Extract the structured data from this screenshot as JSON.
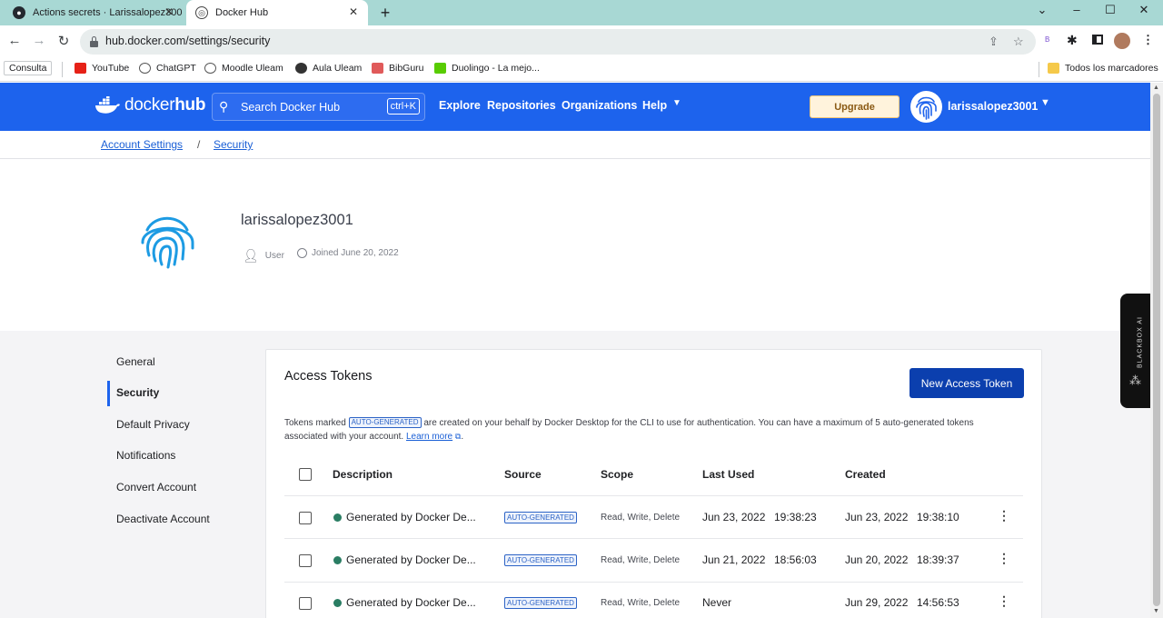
{
  "browser": {
    "tabs": [
      {
        "title": "Actions secrets · Larissalopez300"
      },
      {
        "title": "Docker Hub"
      }
    ],
    "url": "hub.docker.com/settings/security",
    "bookmarks": [
      "Consulta",
      "YouTube",
      "ChatGPT",
      "Moodle Uleam",
      "Aula Uleam",
      "BibGuru",
      "Duolingo - La mejo..."
    ],
    "all_bookmarks": "Todos los marcadores",
    "extension_label": "B"
  },
  "header": {
    "logo_text": "docker",
    "logo_text2": "hub",
    "search_placeholder": "Search Docker Hub",
    "search_shortcut": "ctrl+K",
    "nav": [
      "Explore",
      "Repositories",
      "Organizations",
      "Help"
    ],
    "upgrade_label": "Upgrade",
    "username": "larissalopez3001"
  },
  "breadcrumb": {
    "items": [
      "Account Settings",
      "Security"
    ],
    "separator": "/"
  },
  "profile": {
    "name": "larissalopez3001",
    "role": "User",
    "joined": "Joined June 20, 2022"
  },
  "settings_nav": {
    "items": [
      "General",
      "Security",
      "Default Privacy",
      "Notifications",
      "Convert Account",
      "Deactivate Account"
    ],
    "active": "Security"
  },
  "tokens": {
    "title": "Access Tokens",
    "new_button": "New Access Token",
    "info_pre": "Tokens marked",
    "info_badge": "AUTO-GENERATED",
    "info_post": "are created on your behalf by Docker Desktop for the CLI to use for authentication. You can have a maximum of 5 auto-generated tokens associated with your account.",
    "learn_more": "Learn more",
    "columns": [
      "Description",
      "Source",
      "Scope",
      "Last Used",
      "Created"
    ],
    "rows": [
      {
        "description": "Generated by Docker De...",
        "source": "AUTO-GENERATED",
        "scope": "Read, Write, Delete",
        "last_used_date": "Jun 23, 2022",
        "last_used_time": "19:38:23",
        "created_date": "Jun 23, 2022",
        "created_time": "19:38:10"
      },
      {
        "description": "Generated by Docker De...",
        "source": "AUTO-GENERATED",
        "scope": "Read, Write, Delete",
        "last_used_date": "Jun 21, 2022",
        "last_used_time": "18:56:03",
        "created_date": "Jun 20, 2022",
        "created_time": "18:39:37"
      },
      {
        "description": "Generated by Docker De...",
        "source": "AUTO-GENERATED",
        "scope": "Read, Write, Delete",
        "last_used_date": "Never",
        "last_used_time": "",
        "created_date": "Jun 29, 2022",
        "created_time": "14:56:53"
      }
    ]
  },
  "blackbox_label": "BLACKBOX AI",
  "colors": {
    "docker_blue": "#1d63ed",
    "button_blue": "#0b3fae",
    "status_green": "#2a7d63",
    "tab_strip": "#a8d8d4"
  }
}
